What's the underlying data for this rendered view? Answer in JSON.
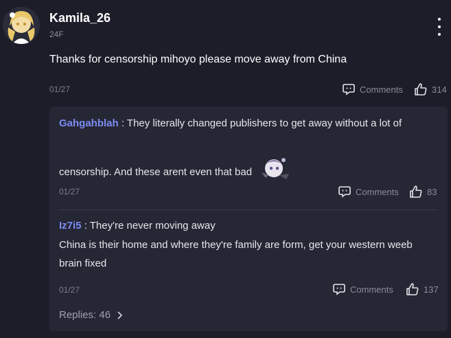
{
  "post": {
    "username": "Kamila_26",
    "floor": "24F",
    "text": "Thanks for censorship mihoyo please move away from China",
    "date": "01/27",
    "comments_label": "Comments",
    "likes": "314"
  },
  "replies": [
    {
      "author": "Gahgahblah",
      "separator": " : ",
      "line1": "They literally changed publishers to get away without a lot of",
      "line2": "censorship. And these arent even that bad",
      "date": "01/27",
      "comments_label": "Comments",
      "likes": "83"
    },
    {
      "author": "Iz7i5",
      "separator": " : ",
      "line1": "They're never moving away",
      "line2": "China is their home and where they're family are form, get your western weeb",
      "line3": "brain fixed",
      "date": "01/27",
      "comments_label": "Comments",
      "likes": "137"
    }
  ],
  "replies_footer": {
    "label": "Replies: 46"
  },
  "icons": {
    "more": "more-vertical-icon",
    "comment": "comment-bubble-icon",
    "like": "thumbs-up-icon",
    "chevron": "chevron-right-icon"
  },
  "colors": {
    "background": "#1c1d29",
    "reply_panel": "#262735",
    "author_link": "#7b8cf4",
    "muted_text": "#8b8c98"
  }
}
